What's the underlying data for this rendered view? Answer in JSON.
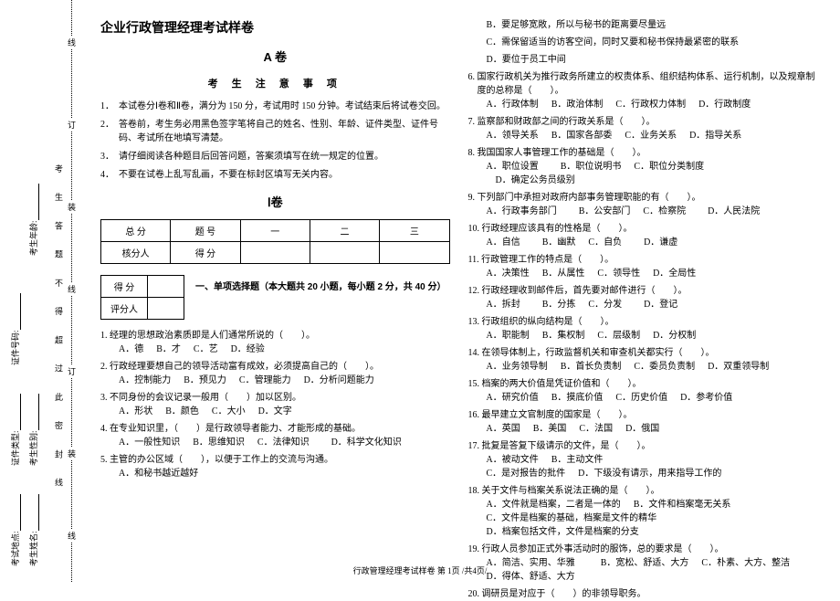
{
  "margin": {
    "items": [
      "考试地点:",
      "考生姓名:",
      "证件类型:",
      "考生性别:",
      "证件号码:",
      "考生年龄:"
    ],
    "fold_marks": [
      "线",
      "订",
      "装",
      "线",
      "订",
      "装",
      "线"
    ],
    "seal_text": "考 生 答 题 不 得 超 过 此 密 封 线"
  },
  "title": "企业行政管理经理考试样卷",
  "paper_label": "A 卷",
  "notice_header": "考 生 注 意 事 项",
  "instructions": [
    "本试卷分Ⅰ卷和Ⅱ卷，满分为 150 分，考试用时 150 分钟。考试结束后将试卷交回。",
    "答卷前，考生务必用黑色签字笔将自己的姓名、性别、年龄、证件类型、证件号码、考试所在地填写清楚。",
    "请仔细阅读各种题目后回答问题，答案须填写在统一规定的位置。",
    "不要在试卷上乱写乱画，不要在标封区填写无关内容。"
  ],
  "juan1": "Ⅰ卷",
  "score_table": {
    "r1c1": "总 分",
    "r1c2": "题 号",
    "r1c3": "一",
    "r1c4": "二",
    "r1c5": "三",
    "r2c1": "核分人",
    "r2c2": "得 分"
  },
  "mini_score": {
    "r1": "得 分",
    "r2": "评分人"
  },
  "section1_title": "一、单项选择题（本大题共 20 小题，每小题 2 分，共 40 分）",
  "questions_left": [
    {
      "n": "1.",
      "text": "经理的思想政治素质即是人们通常所说的（　　）。",
      "opts": [
        "A．德",
        "B．才",
        "C．艺",
        "D．经验"
      ]
    },
    {
      "n": "2.",
      "text": "行政经理要想自己的领导活动富有成效，必须提高自己的（　　）。",
      "opts": [
        "A．控制能力",
        "B．预见力",
        "C．管理能力",
        "D．分析问题能力"
      ]
    },
    {
      "n": "3.",
      "text": "不同身份的会议记录一般用（　　）加以区别。",
      "opts": [
        "A．形状",
        "B．颜色",
        "C．大小",
        "D．文字"
      ]
    },
    {
      "n": "4.",
      "text": "在专业知识里，（　　）是行政领导者能力、才能形成的基础。",
      "opts": [
        "A．一般性知识",
        "B．思维知识",
        "C．法律知识",
        "　D．科学文化知识"
      ]
    },
    {
      "n": "5.",
      "text": "主管的办公区域（　　），以便于工作上的交流与沟通。",
      "opts": [
        "A．和秘书越近越好"
      ]
    }
  ],
  "questions_right_cont": [
    {
      "opts": [
        "B．要足够宽敞，所以与秘书的距离要尽量远"
      ]
    },
    {
      "opts": [
        "C．需保留适当的访客空间，同时又要和秘书保持最紧密的联系"
      ]
    },
    {
      "opts": [
        "D．要位于员工中间"
      ]
    }
  ],
  "questions_right": [
    {
      "n": "6.",
      "text": "国家行政机关为推行政务所建立的权责体系、组织结构体系、运行机制，以及规章制度的总称是（　　）。",
      "opts": [
        "A．行政体制",
        "B．政治体制",
        "C．行政权力体制",
        "D．行政制度"
      ]
    },
    {
      "n": "7.",
      "text": "监察部和财政部之间的行政关系是（　　）。",
      "opts": [
        "A．领导关系",
        "B．国家各部委",
        "C．业务关系",
        "D．指导关系"
      ]
    },
    {
      "n": "8.",
      "text": "我国国家人事管理工作的基础是（　　）。",
      "opts": [
        "A．职位设置",
        "　B．职位说明书",
        "C．职位分类制度",
        "　D．确定公务员级别"
      ]
    },
    {
      "n": "9.",
      "text": "下列部门中承担对政府内部事务管理职能的有（　　）。",
      "opts": [
        "A．行政事务部门",
        "　B．公安部门",
        "C．检察院",
        "　D．人民法院"
      ]
    },
    {
      "n": "10.",
      "text": "行政经理应该具有的性格是（　　）。",
      "opts": [
        "A．自信",
        "　B．幽默",
        "C．自负",
        "　D．谦虚"
      ]
    },
    {
      "n": "11.",
      "text": "行政管理工作的特点是（　　）。",
      "opts": [
        "A．决策性",
        "B．从属性",
        "C．领导性",
        "D．全局性"
      ]
    },
    {
      "n": "12.",
      "text": "行政经理收到邮件后，首先要对邮件进行（　　）。",
      "opts": [
        "A．拆封",
        "　B．分拣",
        "C．分发",
        "　D．登记"
      ]
    },
    {
      "n": "13.",
      "text": "行政组织的纵向结构是（　　）。",
      "opts": [
        "A．职能制",
        "B．集权制",
        "C．层级制",
        "D．分权制"
      ]
    },
    {
      "n": "14.",
      "text": "在领导体制上，行政监督机关和审查机关都实行（　　）。",
      "opts": [
        "A．业务领导制",
        "B．首长负责制",
        "C．委员负责制",
        "D．双重领导制"
      ]
    },
    {
      "n": "15.",
      "text": "档案的两大价值是凭证价值和（　　）。",
      "opts": [
        "A．研究价值",
        "B．摸底价值",
        "C．历史价值",
        "D．参考价值"
      ]
    },
    {
      "n": "16.",
      "text": "最早建立文官制度的国家是（　　）。",
      "opts": [
        "A．英国",
        "B．美国",
        "C．法国",
        "D．俄国"
      ]
    },
    {
      "n": "17.",
      "text": "批复是答复下级请示的文件，是（　　）。",
      "opts_2rows": [
        [
          "A．被动文件",
          "",
          "B．主动文件"
        ],
        [
          "C．是对报告的批件",
          "",
          "D．下级没有请示，用来指导工作的"
        ]
      ]
    },
    {
      "n": "18.",
      "text": "关于文件与档案关系说法正确的是（　　）。",
      "opts_2rows": [
        [
          "A．文件就是档案，二者是一体的",
          "",
          "B．文件和档案毫无关系"
        ],
        [
          "C．文件是档案的基础，档案是文件的精华",
          "",
          "D．档案包括文件，文件是档案的分支"
        ]
      ]
    },
    {
      "n": "19.",
      "text": "行政人员参加正式外事活动时的服饰，总的要求是（　　）。",
      "opts": [
        "A．简洁、实用、华雅",
        "",
        "B．宽松、舒适、大方",
        "C．朴素、大方、整洁",
        "",
        "D．得体、舒适、大方"
      ]
    },
    {
      "n": "20.",
      "text": "调研员是对应于（　　）的非领导职务。"
    }
  ],
  "footer": "行政管理经理考试样卷  第 1页 /共4页/"
}
